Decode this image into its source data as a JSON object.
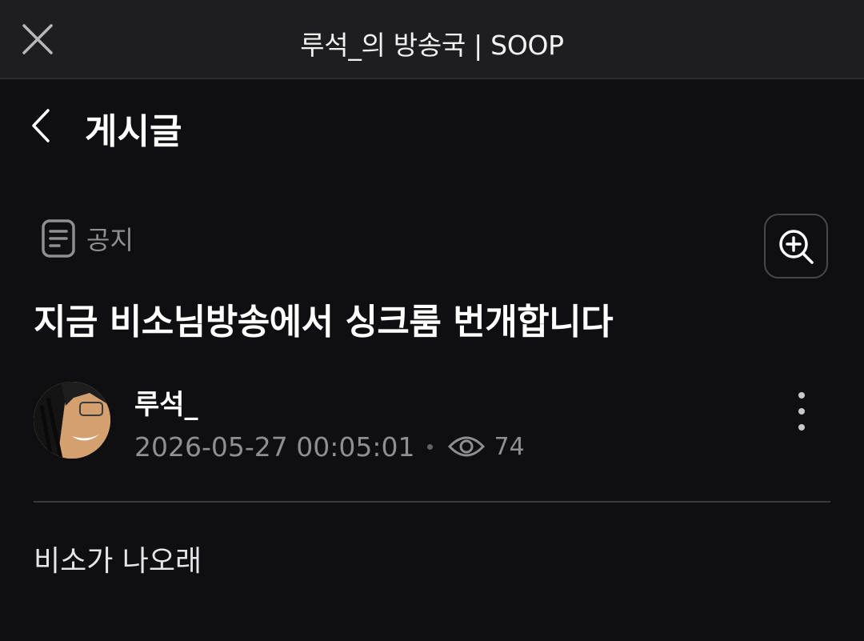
{
  "window": {
    "title": "루석_의 방송국 | SOOP",
    "close_icon": "close-icon"
  },
  "header": {
    "title": "게시글",
    "back_icon": "chevron-left-icon"
  },
  "post": {
    "category": "공지",
    "category_icon": "document-icon",
    "title": "지금 비소님방송에서 싱크룸 번개합니다",
    "author": "루석_",
    "date": "2026-05-27 00:05:01",
    "views": "74",
    "body": "비소가 나오래"
  },
  "actions": {
    "zoom_icon": "zoom-in-icon",
    "more_icon": "more-vertical-icon",
    "views_icon": "eye-icon"
  },
  "colors": {
    "background": "#0f0f11",
    "topbar": "#1e1e20",
    "muted_text": "#8e8e93",
    "divider": "#3a3a3c"
  }
}
